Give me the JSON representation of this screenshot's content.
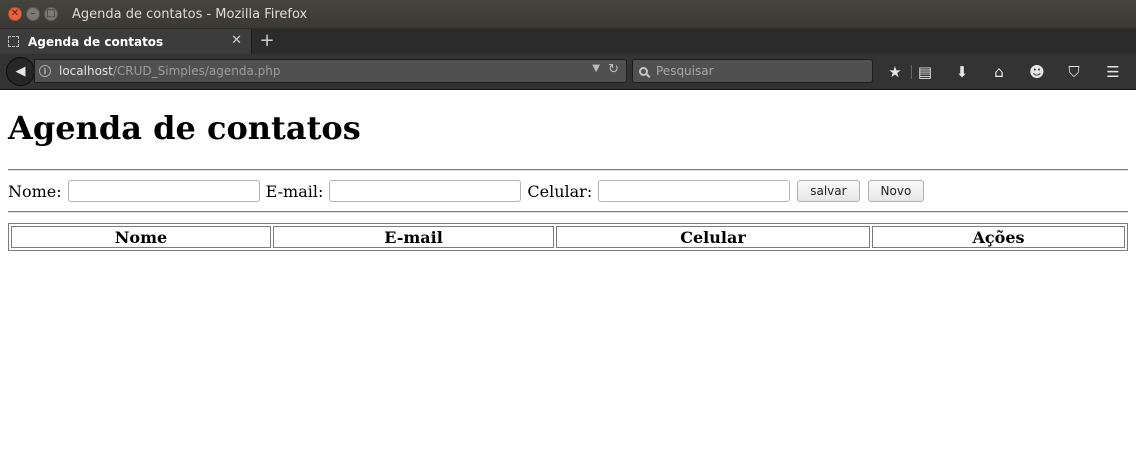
{
  "window": {
    "title": "Agenda de contatos - Mozilla Firefox"
  },
  "tabs": [
    {
      "label": "Agenda de contatos",
      "active": true
    }
  ],
  "navbar": {
    "url_host": "localhost",
    "url_path": "/CRUD_Simples/agenda.php",
    "search_placeholder": "Pesquisar",
    "toolbar_icons": [
      "bookmark-star-icon",
      "reading-list-icon",
      "downloads-icon",
      "home-icon",
      "emoji-icon",
      "pocket-icon",
      "menu-icon"
    ]
  },
  "page": {
    "heading": "Agenda de contatos",
    "form": {
      "nome_label": "Nome:",
      "email_label": "E-mail:",
      "celular_label": "Celular:",
      "nome_value": "",
      "email_value": "",
      "celular_value": "",
      "save_label": "salvar",
      "new_label": "Novo"
    },
    "table": {
      "headers": [
        "Nome",
        "E-mail",
        "Celular",
        "Ações"
      ]
    }
  }
}
